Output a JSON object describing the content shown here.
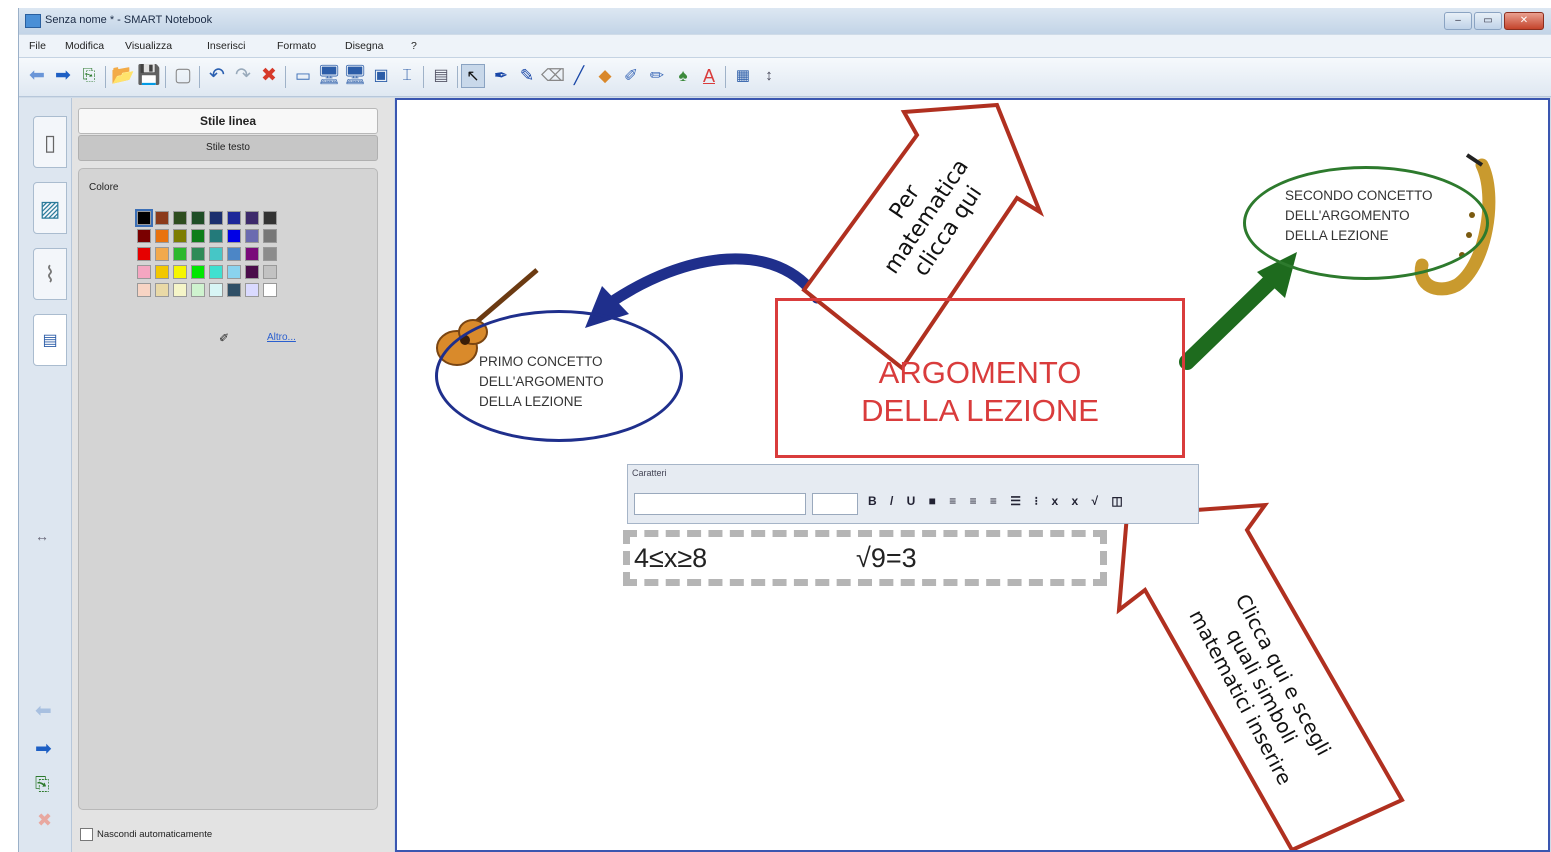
{
  "window": {
    "title": "Senza nome * - SMART Notebook"
  },
  "menu": {
    "items": [
      "File",
      "Modifica",
      "Visualizza",
      "Inserisci",
      "Formato",
      "Disegna",
      "?"
    ]
  },
  "panel": {
    "header": "Stile linea",
    "subheader": "Stile testo",
    "color_label": "Colore",
    "more_link": "Altro...",
    "autohide_label": "Nascondi automaticamente",
    "selected_swatch": "#000000",
    "swatches": [
      "#000000",
      "#8b3a1a",
      "#2e4d1f",
      "#1f4d26",
      "#1c2f6e",
      "#1d2799",
      "#3d2a6b",
      "#333333",
      "#7a0000",
      "#e8730f",
      "#7d7d00",
      "#0e7d1a",
      "#237a7a",
      "#0000e6",
      "#6b6bb0",
      "#777777",
      "#e60000",
      "#f2a94c",
      "#2db82d",
      "#2e8b57",
      "#46c6c6",
      "#4c86c6",
      "#7a0a7a",
      "#8c8c8c",
      "#f4a6c1",
      "#f2c700",
      "#f5f500",
      "#00e600",
      "#40e0d0",
      "#8ad3ee",
      "#4b0d4b",
      "#c2c2c2",
      "#f7d4c4",
      "#e9d9a6",
      "#f5f5c8",
      "#cff3cf",
      "#d8f5f5",
      "#2f4f66",
      "#dadaff",
      "#ffffff"
    ]
  },
  "canvas": {
    "main_topic": [
      "ARGOMENTO",
      "DELLA LEZIONE"
    ],
    "concept1": [
      "PRIMO CONCETTO",
      "DELL'ARGOMENTO",
      "DELLA LEZIONE"
    ],
    "concept2": [
      "SECONDO CONCETTO",
      "DELL'ARGOMENTO",
      "DELLA LEZIONE"
    ],
    "formula1": "4≤x≥8",
    "formula2": "√9=3",
    "characters_toolbar_title": "Caratteri",
    "callout_top": [
      "Per",
      "matematica",
      "clicca qui"
    ],
    "callout_bottom": [
      "Clicca qui e scegli",
      "quali simboli",
      "matematici inserire"
    ]
  },
  "colors": {
    "main_topic": "#d93c3c",
    "concept1_border": "#1f2f8c",
    "concept2_border": "#2d7a2d",
    "callout_border": "#b03020",
    "canvas_border": "#3a56b0"
  }
}
